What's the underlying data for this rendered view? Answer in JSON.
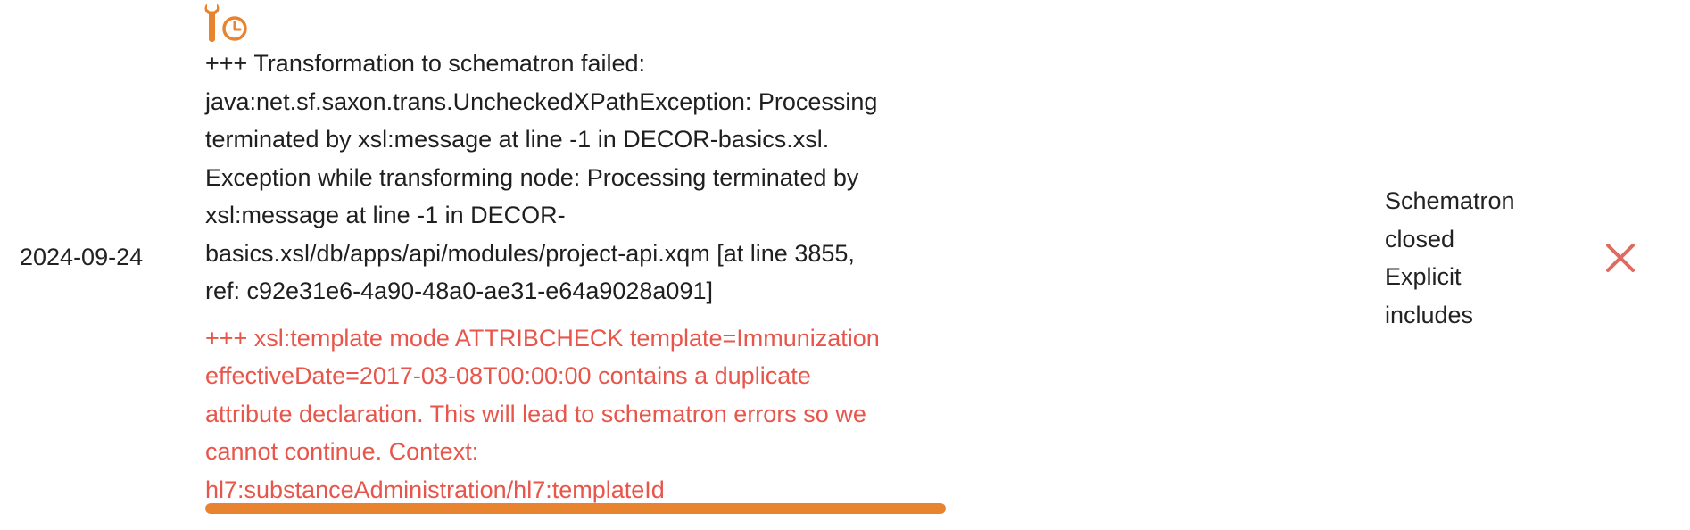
{
  "row": {
    "date": "2024-09-24",
    "status_icon": "wrench-clock-icon",
    "message_lines": [
      "+++ Transformation to schematron failed:",
      "java:net.sf.saxon.trans.UncheckedXPathException: Processing",
      "terminated by xsl:message at line -1 in DECOR-basics.xsl.",
      "Exception while transforming node: Processing terminated by",
      "xsl:message at line -1 in DECOR-",
      "basics.xsl/db/apps/api/modules/project-api.xqm [at line 3855,",
      "ref: c92e31e6-4a90-48a0-ae31-e64a9028a091]"
    ],
    "error_lines": [
      "+++ xsl:template mode ATTRIBCHECK template=Immunization",
      "effectiveDate=2017-03-08T00:00:00 contains a duplicate",
      "attribute declaration. This will lead to schematron errors so we",
      "cannot continue. Context:",
      "hl7:substanceAdministration/hl7:templateId"
    ],
    "progress_percent": 100,
    "options_lines": [
      "Schematron",
      "closed",
      "Explicit",
      "includes"
    ],
    "close_icon": "close-icon"
  },
  "colors": {
    "accent": "#e8832f",
    "error": "#e8554a",
    "close": "#e06a5e"
  }
}
